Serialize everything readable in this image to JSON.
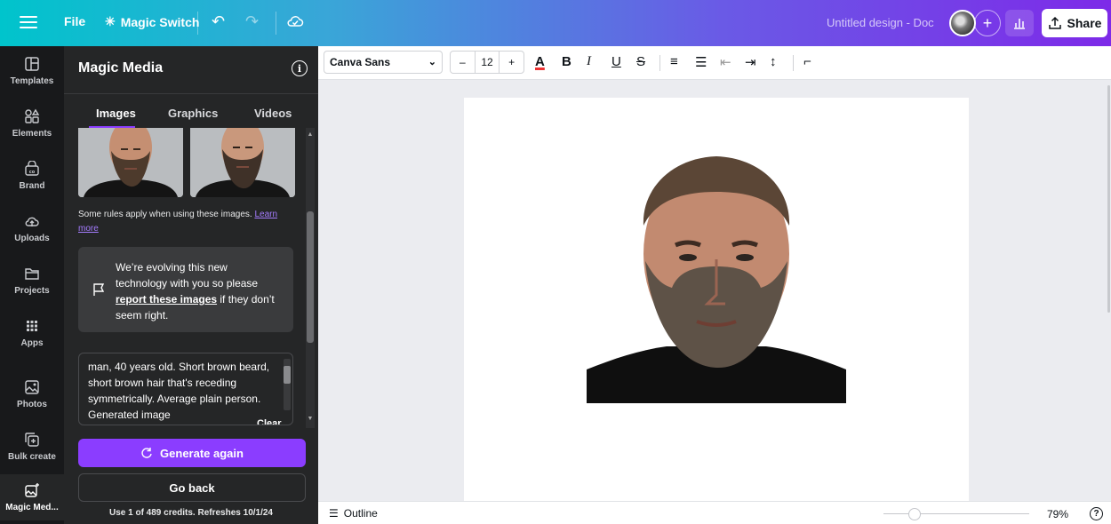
{
  "topbar": {
    "file_label": "File",
    "magic_switch_label": "Magic Switch",
    "doc_title": "Untitled design - Doc",
    "share_label": "Share"
  },
  "rail": {
    "items": [
      {
        "label": "Templates",
        "icon": "templates-icon"
      },
      {
        "label": "Elements",
        "icon": "elements-icon"
      },
      {
        "label": "Brand",
        "icon": "brand-icon"
      },
      {
        "label": "Uploads",
        "icon": "uploads-icon"
      },
      {
        "label": "Projects",
        "icon": "projects-icon"
      },
      {
        "label": "Apps",
        "icon": "apps-icon"
      },
      {
        "label": "Photos",
        "icon": "photos-icon"
      },
      {
        "label": "Bulk create",
        "icon": "bulk-create-icon"
      },
      {
        "label": "Magic Med...",
        "icon": "magic-media-icon"
      }
    ]
  },
  "panel": {
    "title": "Magic Media",
    "tabs": [
      "Images",
      "Graphics",
      "Videos"
    ],
    "active_tab": "Images",
    "rules_text": "Some rules apply when using these images.",
    "learn_more": "Learn more",
    "feedback_prefix": "We’re evolving this new technology with you so please",
    "feedback_link": "report these images",
    "feedback_suffix": "if they don’t seem right.",
    "prompt": "man, 40 years old. Short brown beard, short brown hair that's receding symmetrically. Average plain person. Generated image",
    "clear_label": "Clear",
    "generate_label": "Generate again",
    "goback_label": "Go back",
    "credits": "Use 1 of 489 credits. Refreshes 10/1/24"
  },
  "toolbar": {
    "font": "Canva Sans",
    "size_minus": "–",
    "font_size": "12",
    "size_plus": "+"
  },
  "bottombar": {
    "outline_label": "Outline",
    "zoom": "79%"
  },
  "colors": {
    "accent": "#8b3dff",
    "panel_bg": "#252627",
    "rail_bg": "#18191b"
  }
}
